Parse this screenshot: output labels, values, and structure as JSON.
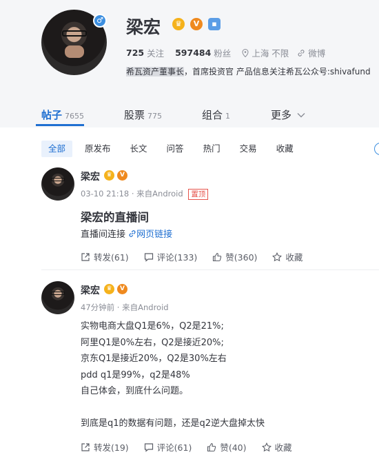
{
  "profile": {
    "name": "梁宏",
    "gender_symbol": "♂",
    "badges": {
      "crown": "♛",
      "verified": "V",
      "org": "▪"
    },
    "following_count": "725",
    "following_label": "关注",
    "followers_count": "597484",
    "followers_label": "粉丝",
    "location": "上海 不限",
    "weibo_label": "微博",
    "bio_highlight": "希瓦资产董事长",
    "bio_rest": "，首席投资官 产品信息关注希瓦公众号:shivafund"
  },
  "tabs": [
    {
      "label": "帖子",
      "count": "7655"
    },
    {
      "label": "股票",
      "count": "775"
    },
    {
      "label": "组合",
      "count": "1"
    },
    {
      "label": "更多",
      "count": ""
    }
  ],
  "filters": [
    "全部",
    "原发布",
    "长文",
    "问答",
    "热门",
    "交易",
    "收藏"
  ],
  "posts": [
    {
      "author": "梁宏",
      "time": "03-10 21:18",
      "source": "· 来自Android",
      "pin_label": "置顶",
      "title": "梁宏的直播间",
      "body_prefix": "直播间连接",
      "link_label": "网页链接",
      "repost": "转发(61)",
      "comment": "评论(133)",
      "like": "赞(360)",
      "fav": "收藏"
    },
    {
      "author": "梁宏",
      "time": "47分钟前",
      "source": "· 来自Android",
      "lines": [
        "实物电商大盘Q1是6%，Q2是21%;",
        "阿里Q1是0%左右，Q2是接近20%;",
        "京东Q1是接近20%，Q2是30%左右",
        "pdd q1是99%，q2是48%",
        "自己体会，到底什么问题。",
        "",
        "到底是q1的数据有问题，还是q2逆大盘掉太快"
      ],
      "repost": "转发(19)",
      "comment": "评论(61)",
      "like": "赞(40)",
      "fav": "收藏"
    }
  ],
  "colors": {
    "accent": "#1f6fd1",
    "pin": "#e6534b",
    "crown": "#f5b21c",
    "verified": "#ef8a1f"
  }
}
